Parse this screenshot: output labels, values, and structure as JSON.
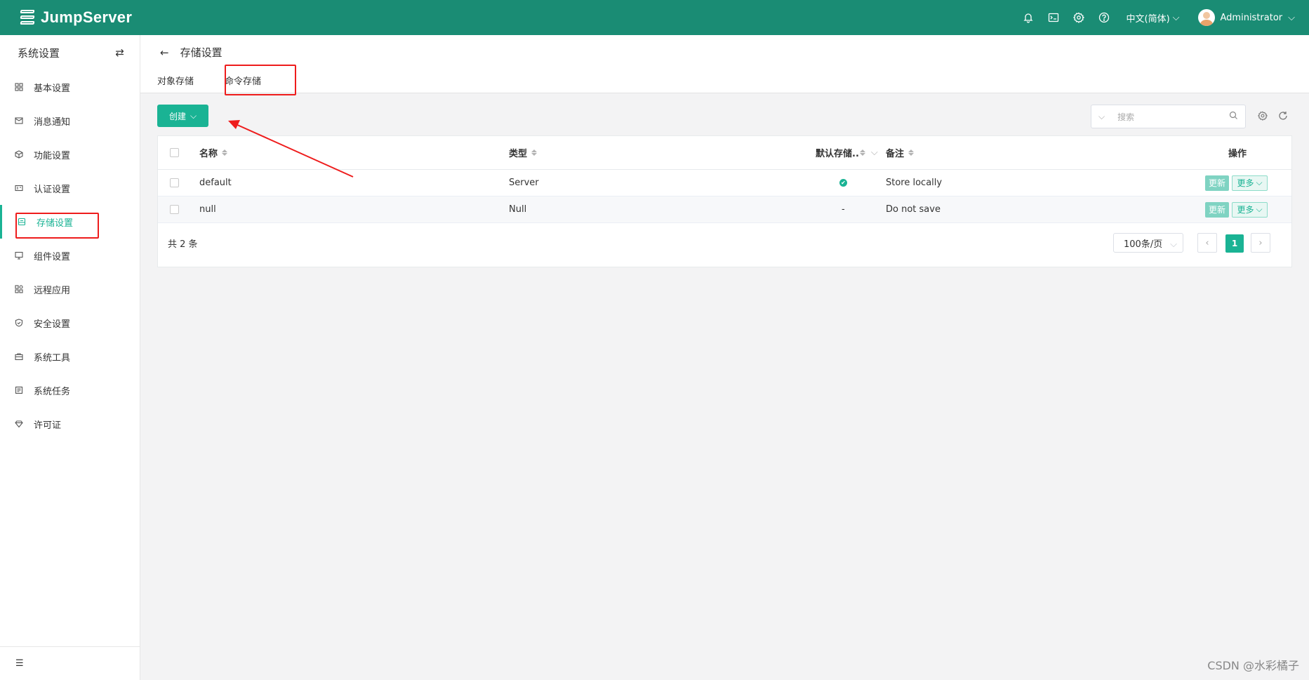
{
  "topbar": {
    "brand": "JumpServer",
    "language": "中文(简体)",
    "user": "Administrator",
    "icons": [
      "bell-icon",
      "terminal-icon",
      "gear-icon",
      "help-icon"
    ]
  },
  "sidebar": {
    "title": "系统设置",
    "items": [
      {
        "label": "基本设置",
        "icon": "grid-icon"
      },
      {
        "label": "消息通知",
        "icon": "message-icon"
      },
      {
        "label": "功能设置",
        "icon": "cube-icon"
      },
      {
        "label": "认证设置",
        "icon": "id-card-icon"
      },
      {
        "label": "存储设置",
        "icon": "storage-icon"
      },
      {
        "label": "组件设置",
        "icon": "monitor-icon"
      },
      {
        "label": "远程应用",
        "icon": "apps-icon"
      },
      {
        "label": "安全设置",
        "icon": "shield-icon"
      },
      {
        "label": "系统工具",
        "icon": "toolbox-icon"
      },
      {
        "label": "系统任务",
        "icon": "task-icon"
      },
      {
        "label": "许可证",
        "icon": "diamond-icon"
      }
    ],
    "active_index": 4
  },
  "page": {
    "title": "存储设置",
    "tabs": [
      "对象存储",
      "命令存储"
    ],
    "active_tab": 1
  },
  "toolbar": {
    "create_label": "创建",
    "search_placeholder": "搜索"
  },
  "table": {
    "headers": {
      "name": "名称",
      "type": "类型",
      "default": "默认存储..",
      "comment": "备注",
      "actions": "操作"
    },
    "rows": [
      {
        "name": "default",
        "type": "Server",
        "default": "✔",
        "comment": "Store locally"
      },
      {
        "name": "null",
        "type": "Null",
        "default": "-",
        "comment": "Do not save"
      }
    ],
    "update_label": "更新",
    "more_label": "更多",
    "total": "共 2 条",
    "page_size": "100条/页",
    "current_page": "1"
  },
  "watermark": "CSDN @水彩橘子",
  "colors": {
    "brand": "#1a8c74",
    "accent": "#1ab394",
    "annotation": "#ee1c1c"
  }
}
